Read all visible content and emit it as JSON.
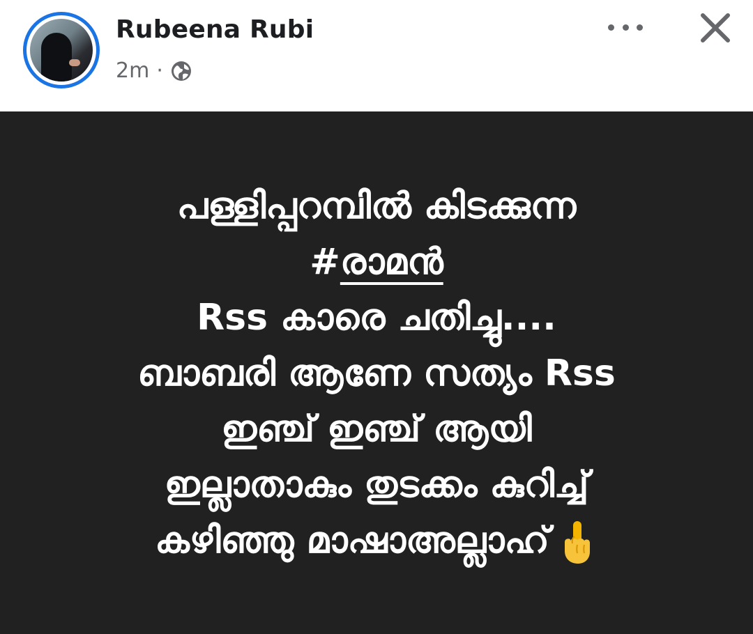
{
  "post": {
    "author": "Rubeena Rubi",
    "time": "2m",
    "separator": "·",
    "audience_icon": "globe-icon",
    "more_icon": "more-horizontal-icon",
    "close_icon": "close-icon"
  },
  "content": {
    "background": "#212121",
    "text_color": "#ffffff",
    "lines": [
      "പള്ളിപ്പറമ്പിൽ കിടക്കുന്ന",
      "#",
      "രാമൻ",
      "Rss കാരെ ചതിച്ചു....",
      "ബാബരി ആണേ സത്യം Rss",
      "ഇഞ്ച് ഇഞ്ച് ആയി",
      "ഇല്ലാതാകും  തുടക്കം കുറിച്ച്",
      "കഴിഞ്ഞു മാഷാഅല്ലാഹ്"
    ],
    "emoji_icon": "pointing-up-icon"
  },
  "colors": {
    "avatar_ring": "#1b74e4",
    "secondary_text": "#65676b",
    "author_text": "#1c1e21"
  }
}
